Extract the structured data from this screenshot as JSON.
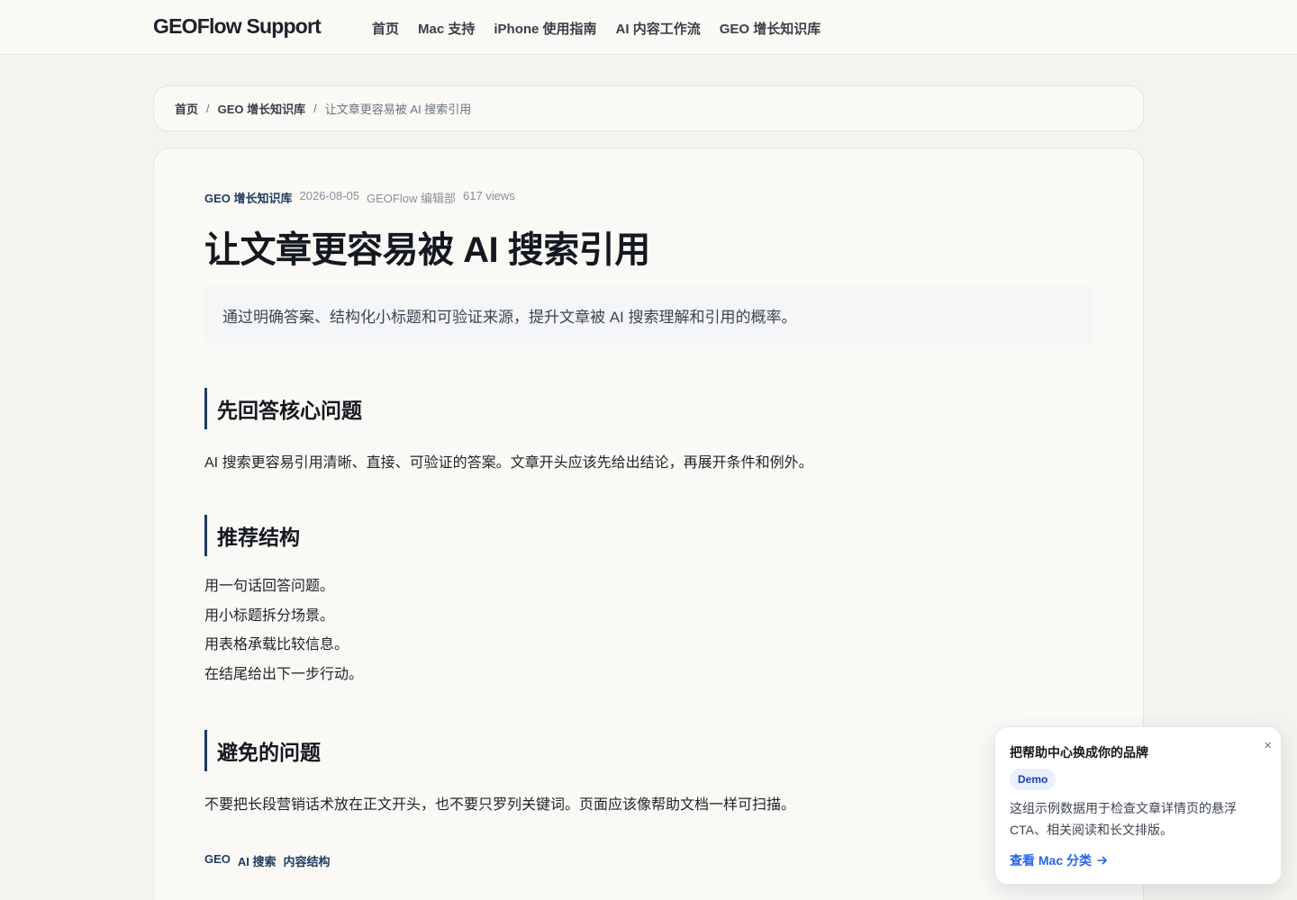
{
  "header": {
    "brand": "GEOFlow Support",
    "nav": [
      {
        "label": "首页"
      },
      {
        "label": "Mac 支持"
      },
      {
        "label": "iPhone 使用指南"
      },
      {
        "label": "AI 内容工作流"
      },
      {
        "label": "GEO 增长知识库"
      }
    ]
  },
  "breadcrumb": {
    "home": "首页",
    "separator": "/",
    "category": "GEO 增长知识库",
    "current": "让文章更容易被 AI 搜索引用"
  },
  "article": {
    "category": "GEO 增长知识库",
    "date": "2026-08-05",
    "author": "GEOFlow 编辑部",
    "views": "617 views",
    "title": "让文章更容易被 AI 搜索引用",
    "summary": "通过明确答案、结构化小标题和可验证来源，提升文章被 AI 搜索理解和引用的概率。",
    "sections": [
      {
        "heading": "先回答核心问题",
        "body": "AI 搜索更容易引用清晰、直接、可验证的答案。文章开头应该先给出结论，再展开条件和例外。"
      },
      {
        "heading": "推荐结构",
        "items": [
          "用一句话回答问题。",
          "用小标题拆分场景。",
          "用表格承载比较信息。",
          "在结尾给出下一步行动。"
        ]
      },
      {
        "heading": "避免的问题",
        "body": "不要把长段营销话术放在正文开头，也不要只罗列关键词。页面应该像帮助文档一样可扫描。"
      }
    ],
    "tags": [
      "GEO",
      "AI 搜索",
      "内容结构"
    ]
  },
  "popup": {
    "title": "把帮助中心换成你的品牌",
    "close": "×",
    "badge": "Demo",
    "description": "这组示例数据用于检查文章详情页的悬浮 CTA、相关阅读和长文排版。",
    "link": "查看 Mac 分类"
  },
  "colors": {
    "accent": "#1e3a5f",
    "link": "#2563eb",
    "background": "#f4f3ee"
  }
}
